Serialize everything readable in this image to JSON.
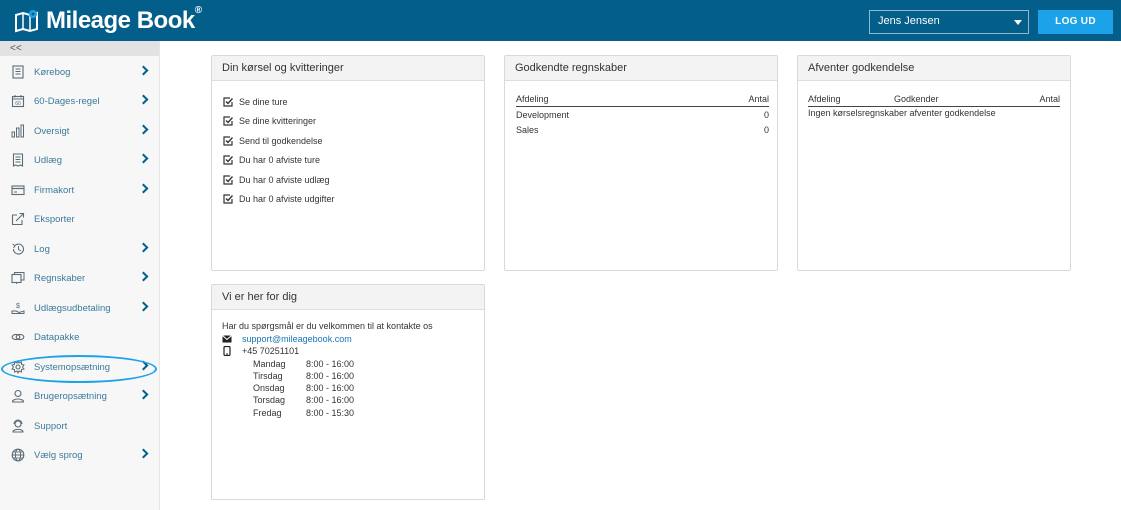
{
  "app": {
    "name": "Mileage Book",
    "trademark": "®"
  },
  "header": {
    "user": "Jens Jensen",
    "logout_label": "LOG UD"
  },
  "sidebar": {
    "collapse_label": "<<",
    "items": [
      {
        "label": "Kørebog",
        "icon": "book-icon",
        "chevron": true
      },
      {
        "label": "60-Dages-regel",
        "icon": "calendar-60-icon",
        "chevron": true
      },
      {
        "label": "Oversigt",
        "icon": "bar-chart-icon",
        "chevron": true
      },
      {
        "label": "Udlæg",
        "icon": "receipt-icon",
        "chevron": true
      },
      {
        "label": "Firmakort",
        "icon": "credit-card-icon",
        "chevron": true
      },
      {
        "label": "Eksporter",
        "icon": "export-icon",
        "chevron": false
      },
      {
        "label": "Log",
        "icon": "history-icon",
        "chevron": true
      },
      {
        "label": "Regnskaber",
        "icon": "documents-icon",
        "chevron": true
      },
      {
        "label": "Udlægsudbetaling",
        "icon": "hand-money-icon",
        "chevron": true
      },
      {
        "label": "Datapakke",
        "icon": "link-icon",
        "chevron": false
      },
      {
        "label": "Systemopsætning",
        "icon": "gear-icon",
        "chevron": true
      },
      {
        "label": "Brugeropsætning",
        "icon": "user-icon",
        "chevron": true
      },
      {
        "label": "Support",
        "icon": "support-icon",
        "chevron": false
      },
      {
        "label": "Vælg sprog",
        "icon": "globe-icon",
        "chevron": true
      }
    ]
  },
  "panels": {
    "driving": {
      "title": "Din kørsel og kvitteringer",
      "items": [
        "Se dine ture",
        "Se dine kvitteringer",
        "Send til godkendelse",
        "Du har 0 afviste ture",
        "Du har 0 afviste udlæg",
        "Du har 0 afviste udgifter"
      ]
    },
    "approved": {
      "title": "Godkendte regnskaber",
      "columns": [
        "Afdeling",
        "Antal"
      ],
      "rows": [
        {
          "department": "Development",
          "count": "0"
        },
        {
          "department": "Sales",
          "count": "0"
        }
      ]
    },
    "pending": {
      "title": "Afventer godkendelse",
      "columns": [
        "Afdeling",
        "Godkender",
        "Antal"
      ],
      "empty_text": "Ingen kørselsregnskaber afventer godkendelse"
    },
    "help": {
      "title": "Vi er her for dig",
      "intro": "Har du spørgsmål er du velkommen til at kontakte os",
      "email": "support@mileagebook.com",
      "phone": "+45 70251101",
      "hours": [
        {
          "day": "Mandag",
          "time": "8:00 - 16:00"
        },
        {
          "day": "Tirsdag",
          "time": "8:00 - 16:00"
        },
        {
          "day": "Onsdag",
          "time": "8:00 - 16:00"
        },
        {
          "day": "Torsdag",
          "time": "8:00 - 16:00"
        },
        {
          "day": "Fredag",
          "time": "8:00 - 15:30"
        }
      ]
    }
  },
  "colors": {
    "header": "#035e8a",
    "accent": "#1ba2e8",
    "link": "#1a74b8"
  }
}
